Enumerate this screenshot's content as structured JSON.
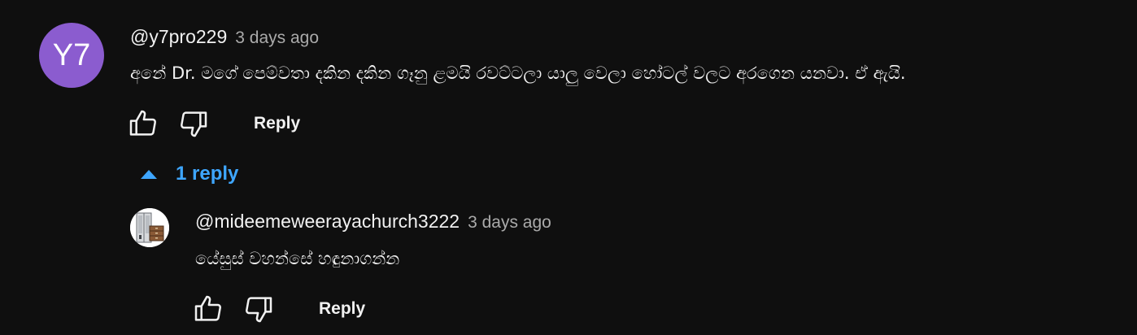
{
  "colors": {
    "background": "#0f0f0f",
    "avatar_main_bg": "#8b5ccf",
    "accent_blue": "#3ea6ff",
    "muted_text": "#aaaaaa"
  },
  "comment": {
    "avatar_initials": "Y7",
    "author": "@y7pro229",
    "timestamp": "3 days ago",
    "text": "අනේ Dr. මගේ පෙම්වතා දකින දකින ගෑනු ළමයි රවට්ටලා යාලු වෙලා හෝටල් වලට අරගෙන යනවා. ඒ ඇයි.",
    "actions": {
      "like_icon": "thumbs-up-icon",
      "dislike_icon": "thumbs-down-icon",
      "reply_label": "Reply"
    }
  },
  "replies_toggle": {
    "icon": "caret-up-icon",
    "label": "1 reply"
  },
  "reply": {
    "avatar_icon": "furniture-avatar-icon",
    "author": "@mideemeweerayachurch3222",
    "timestamp": "3 days ago",
    "text": "යේසුස් වහන්සේ හඳුනාගන්න",
    "actions": {
      "like_icon": "thumbs-up-icon",
      "dislike_icon": "thumbs-down-icon",
      "reply_label": "Reply"
    }
  }
}
